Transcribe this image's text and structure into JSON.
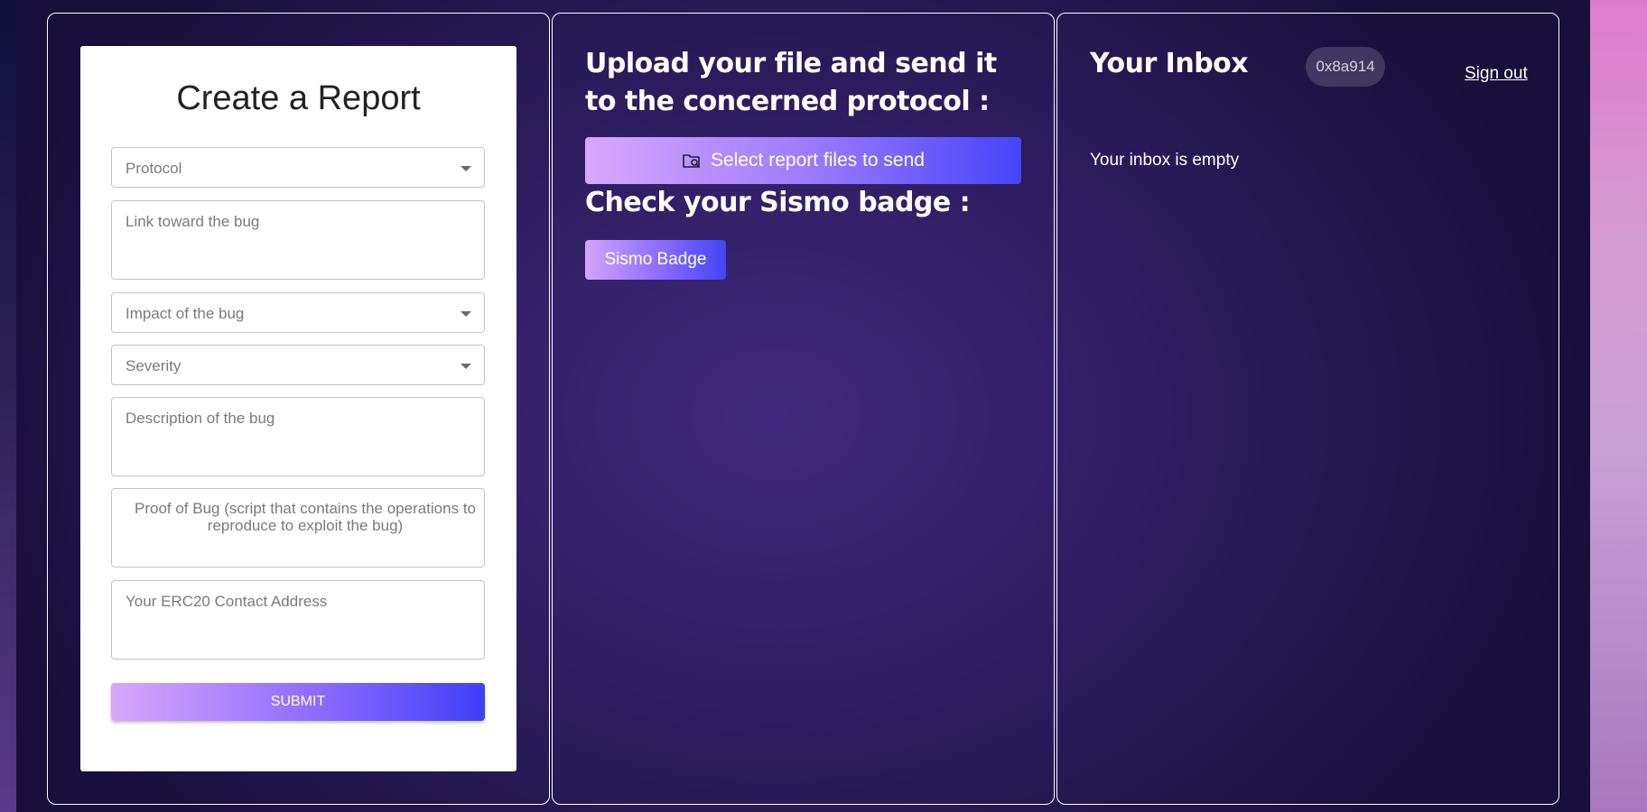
{
  "report_form": {
    "title": "Create a Report",
    "protocol_placeholder": "Protocol",
    "link_placeholder": "Link toward the bug",
    "impact_placeholder": "Impact of the bug",
    "severity_placeholder": "Severity",
    "description_placeholder": "Description of the bug",
    "proof_placeholder": "Proof of Bug (script that contains the operations to reproduce to exploit the bug)",
    "contact_placeholder": "Your ERC20 Contact Address",
    "submit_label": "SUBMIT"
  },
  "upload": {
    "heading": "Upload your file and send it to the concerned protocol :",
    "button_label": "Select report files to send",
    "button_icon": "folder-search-icon"
  },
  "sismo": {
    "heading": "Check your Sismo badge :",
    "button_label": "Sismo Badge"
  },
  "inbox": {
    "title": "Your Inbox",
    "address": "0x8a914",
    "sign_out_label": "Sign out",
    "empty_message": "Your inbox is empty"
  },
  "colors": {
    "gradient_start": "#d8a8fa",
    "gradient_end": "#3f3ff6",
    "background": "#2f1e63",
    "panel_border": "#ffffff"
  }
}
